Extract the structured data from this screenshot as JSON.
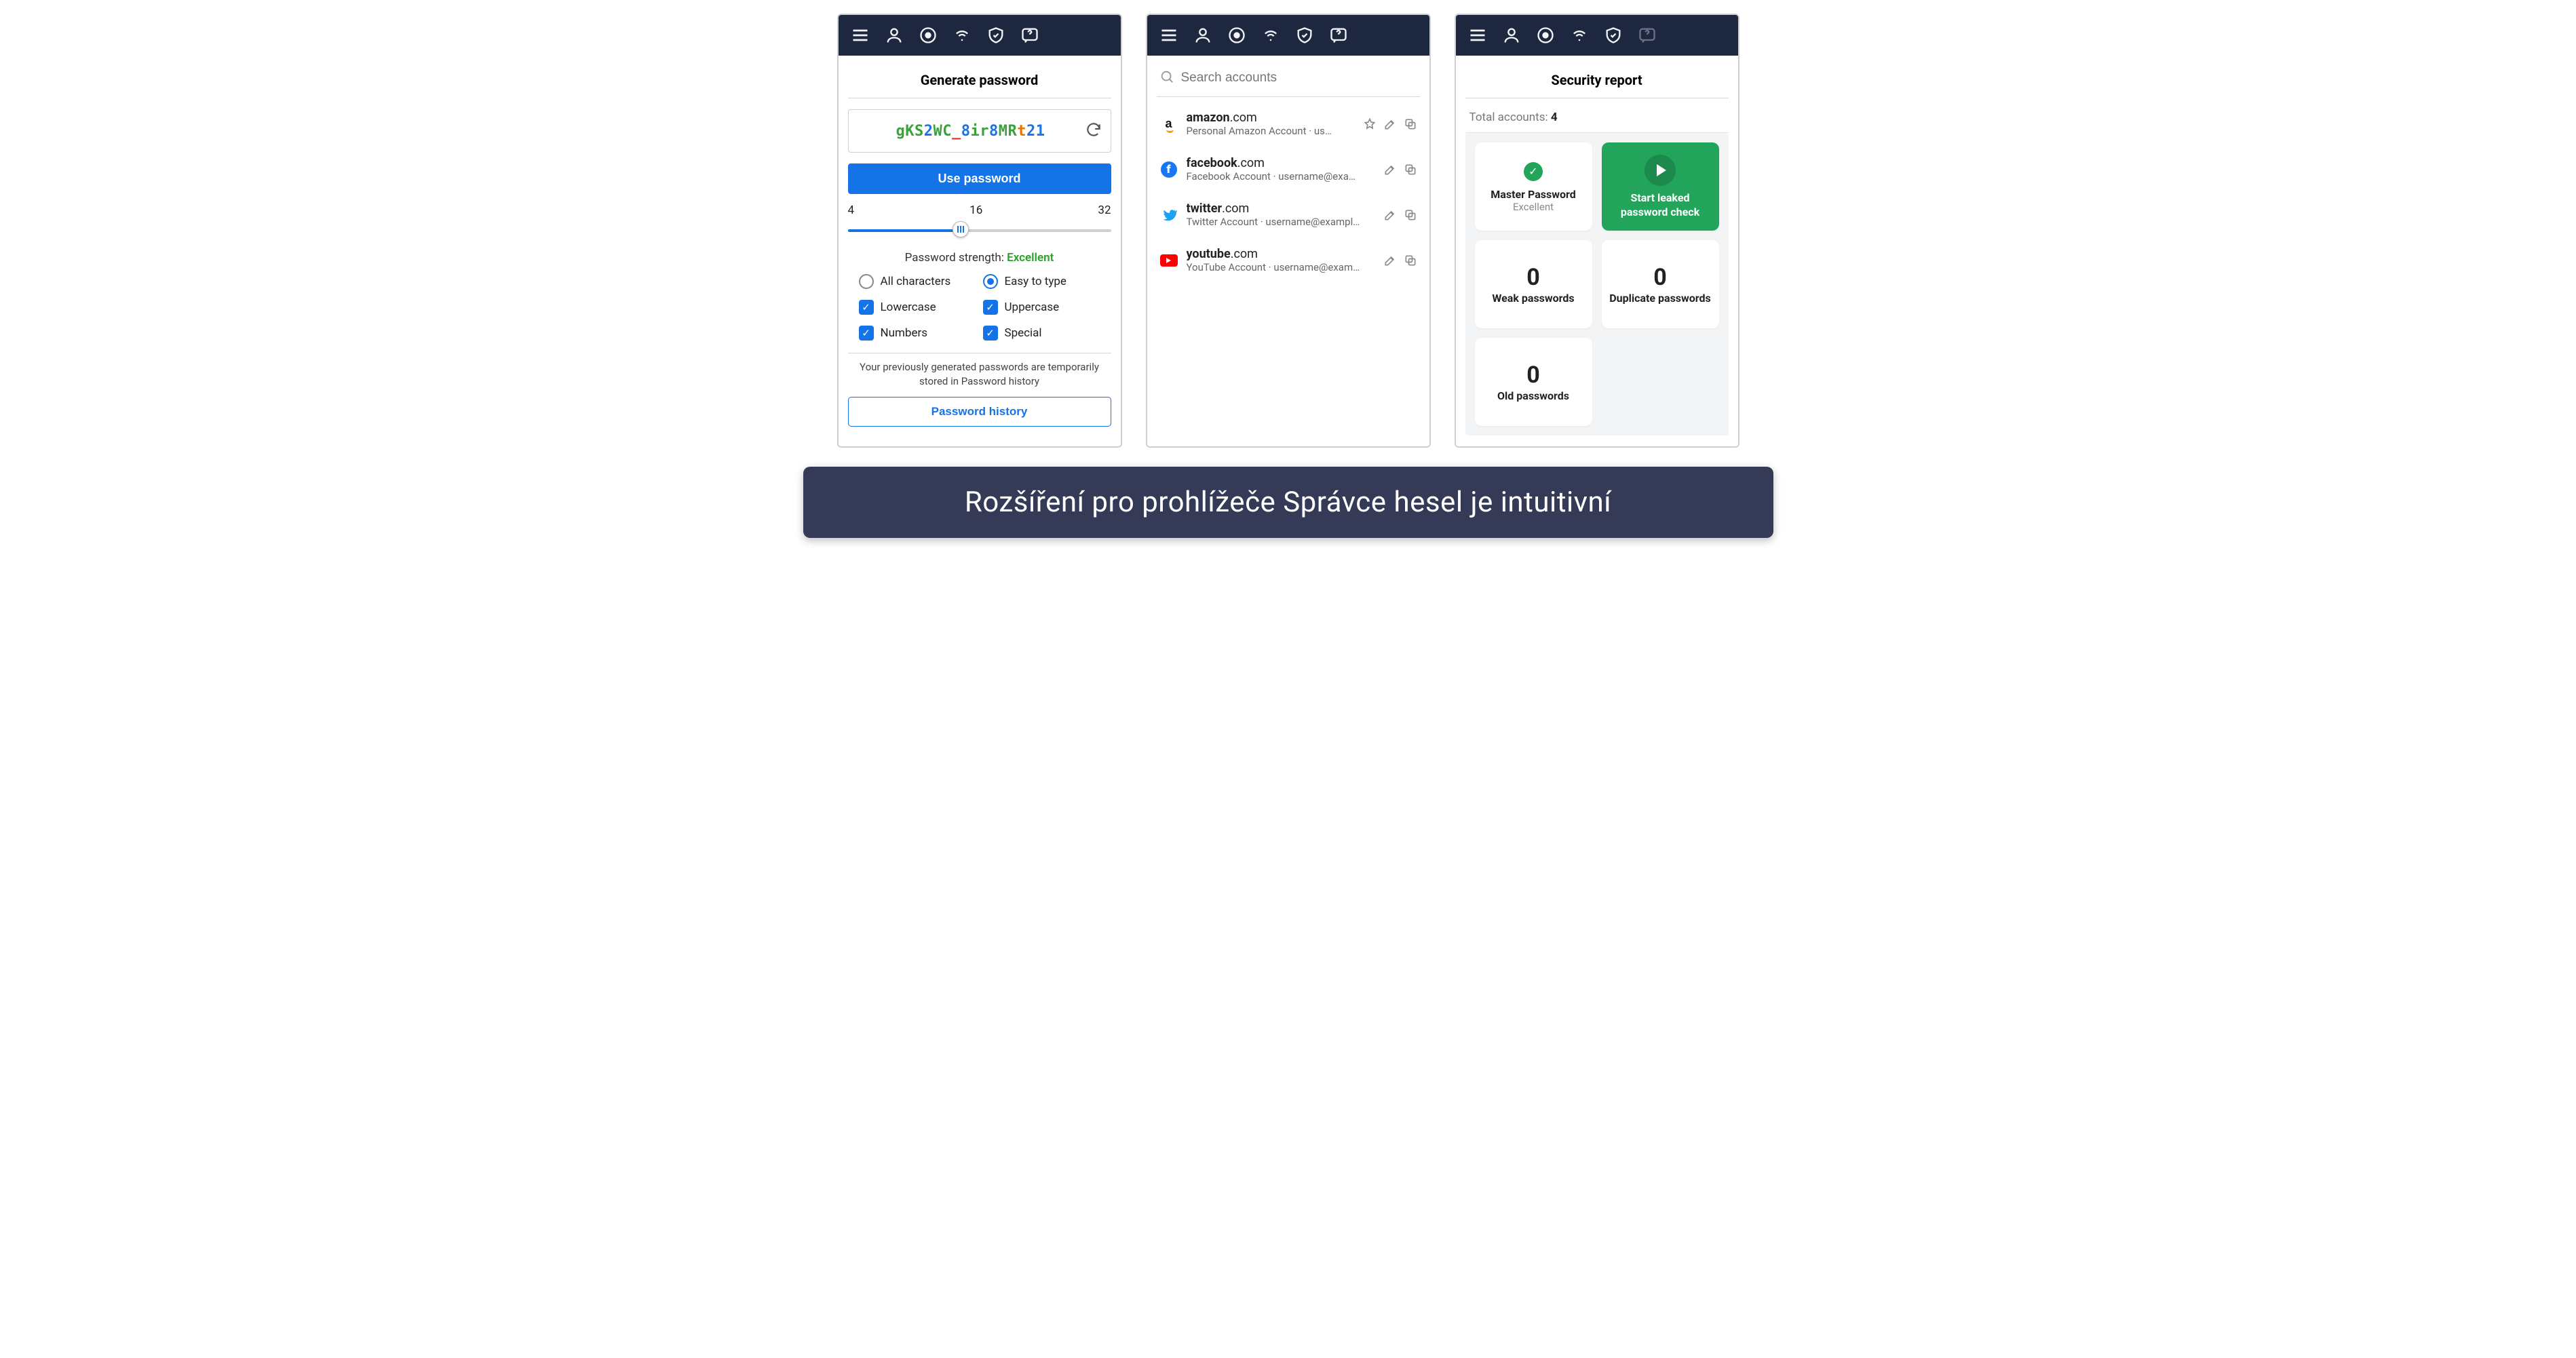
{
  "toolbar": {
    "items": [
      "menu",
      "user",
      "globe",
      "wifi",
      "shield",
      "help"
    ]
  },
  "generator": {
    "title": "Generate password",
    "password_chars": [
      {
        "c": "g",
        "cls": "c-g"
      },
      {
        "c": "K",
        "cls": "c-g"
      },
      {
        "c": "S",
        "cls": "c-g"
      },
      {
        "c": "2",
        "cls": "c-b"
      },
      {
        "c": "W",
        "cls": "c-g"
      },
      {
        "c": "C",
        "cls": "c-g"
      },
      {
        "c": "_",
        "cls": "c-r"
      },
      {
        "c": "8",
        "cls": "c-b"
      },
      {
        "c": "i",
        "cls": "c-g"
      },
      {
        "c": "r",
        "cls": "c-g"
      },
      {
        "c": "8",
        "cls": "c-b"
      },
      {
        "c": "M",
        "cls": "c-g"
      },
      {
        "c": "R",
        "cls": "c-g"
      },
      {
        "c": "t",
        "cls": "c-o"
      },
      {
        "c": "2",
        "cls": "c-b"
      },
      {
        "c": "1",
        "cls": "c-b"
      }
    ],
    "use_btn": "Use password",
    "slider": {
      "min": "4",
      "mid": "16",
      "max": "32",
      "pct": 43
    },
    "strength_label": "Password strength: ",
    "strength_value": "Excellent",
    "opts": {
      "all_chars": "All characters",
      "easy": "Easy to type",
      "lowercase": "Lowercase",
      "uppercase": "Uppercase",
      "numbers": "Numbers",
      "special": "Special"
    },
    "history_text": "Your previously generated passwords are temporarily stored in Password history",
    "history_btn": "Password history"
  },
  "accounts": {
    "search_placeholder": "Search accounts",
    "items": [
      {
        "brand": "amazon",
        "domain_bold": "amazon",
        "domain_rest": ".com",
        "sub": "Personal Amazon Account · us…",
        "star": true
      },
      {
        "brand": "facebook",
        "domain_bold": "facebook",
        "domain_rest": ".com",
        "sub": "Facebook Account · username@exa…",
        "star": false
      },
      {
        "brand": "twitter",
        "domain_bold": "twitter",
        "domain_rest": ".com",
        "sub": "Twitter Account · username@exampl…",
        "star": false
      },
      {
        "brand": "youtube",
        "domain_bold": "youtube",
        "domain_rest": ".com",
        "sub": "YouTube Account · username@exam…",
        "star": false
      }
    ]
  },
  "report": {
    "title": "Security report",
    "total_label": "Total accounts: ",
    "total_value": "4",
    "master": {
      "title": "Master Password",
      "status": "Excellent"
    },
    "start_check": "Start leaked password check",
    "weak": {
      "count": "0",
      "label": "Weak passwords"
    },
    "dup": {
      "count": "0",
      "label": "Duplicate passwords"
    },
    "old": {
      "count": "0",
      "label": "Old passwords"
    }
  },
  "caption": "Rozšíření pro prohlížeče Správce hesel je intuitivní"
}
